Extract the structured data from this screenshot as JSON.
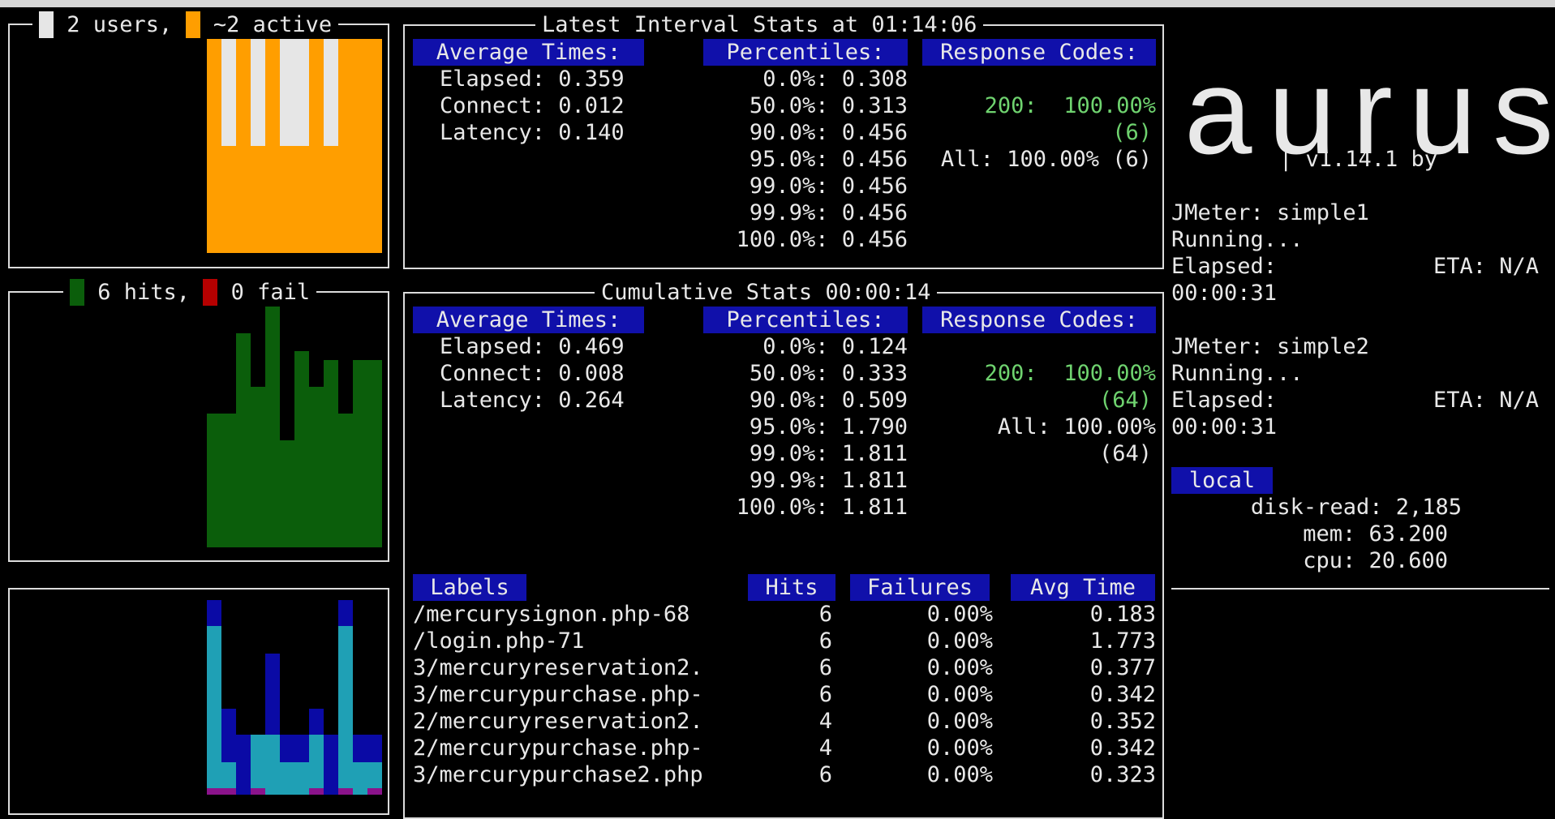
{
  "users_box": {
    "users": "2 users,",
    "active": "~2 active"
  },
  "hits_box": {
    "hits": "6 hits,",
    "fail": "0 fail"
  },
  "latest": {
    "title": "Latest Interval Stats at 01:14:06",
    "avg_header": "Average Times:",
    "pct_header": "Percentiles:",
    "rc_header": "Response Codes:",
    "avg": [
      "Elapsed: 0.359",
      "Connect: 0.012",
      "Latency: 0.140"
    ],
    "pct": [
      "0.0%: 0.308",
      "50.0%: 0.313",
      "90.0%: 0.456",
      "95.0%: 0.456",
      "99.0%: 0.456",
      "99.9%: 0.456",
      "100.0%: 0.456"
    ],
    "rc": [
      "200:  100.00%",
      "(6)",
      "All: 100.00% (6)"
    ]
  },
  "cumulative": {
    "title": "Cumulative Stats 00:00:14",
    "avg_header": "Average Times:",
    "pct_header": "Percentiles:",
    "rc_header": "Response Codes:",
    "avg": [
      "Elapsed: 0.469",
      "Connect: 0.008",
      "Latency: 0.264"
    ],
    "pct": [
      "0.0%: 0.124",
      "50.0%: 0.333",
      "90.0%: 0.509",
      "95.0%: 1.790",
      "99.0%: 1.811",
      "99.9%: 1.811",
      "100.0%: 1.811"
    ],
    "rc": [
      "200:  100.00%",
      "(64)",
      "All: 100.00%",
      "(64)"
    ]
  },
  "labels_table": {
    "headers": [
      "Labels",
      "Hits",
      "Failures",
      "Avg Time"
    ],
    "rows": [
      [
        "/mercurysignon.php-68",
        "6",
        "0.00%",
        "0.183"
      ],
      [
        "/login.php-71",
        "6",
        "0.00%",
        "1.773"
      ],
      [
        "3/mercuryreservation2.",
        "6",
        "0.00%",
        "0.377"
      ],
      [
        "3/mercurypurchase.php-",
        "6",
        "0.00%",
        "0.342"
      ],
      [
        "2/mercuryreservation2.",
        "4",
        "0.00%",
        "0.352"
      ],
      [
        "2/mercurypurchase.php-",
        "4",
        "0.00%",
        "0.342"
      ],
      [
        "3/mercurypurchase2.php",
        "6",
        "0.00%",
        "0.323"
      ]
    ]
  },
  "sidebar": {
    "logo": "aurus",
    "version": "| v1.14.1 by",
    "jobs": [
      {
        "name": "JMeter: simple1",
        "status": "Running...",
        "elapsed_label": "Elapsed:",
        "eta": "ETA: N/A",
        "elapsed": "00:00:31"
      },
      {
        "name": "JMeter: simple2",
        "status": "Running...",
        "elapsed_label": "Elapsed:",
        "eta": "ETA: N/A",
        "elapsed": "00:00:31"
      }
    ],
    "local": {
      "label": "local",
      "stats": [
        "disk-read: 2,185",
        "mem: 63.200",
        "cpu: 20.600"
      ]
    }
  },
  "colors": {
    "users": "#ff9e00",
    "active": "#e6e6e6",
    "hits": "#0b5e0b",
    "fail": "#b50000",
    "rt_primary": "#1fa0b5",
    "rt_secondary": "#0a0aa5",
    "rt_tertiary": "#8b138b",
    "header_bg": "#1010aa",
    "ok": "#6fd36f"
  }
}
